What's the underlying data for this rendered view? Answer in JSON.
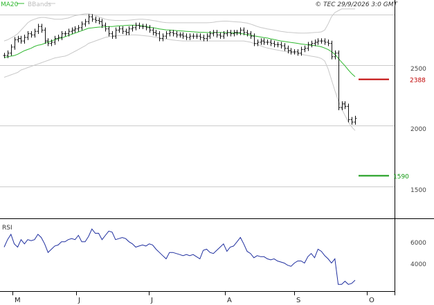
{
  "legend": {
    "ma_label": "MA20",
    "bb_label": "BBands"
  },
  "copyright": "© TEC 29/9/2026 3:0 GMT",
  "colors": {
    "ma": "#2fb82f",
    "bands": "#c8c8c8",
    "price": "#111111",
    "rsi": "#1f2f9f",
    "resistance": "#c00000",
    "support": "#139a13",
    "grid": "#cccccc"
  },
  "chart_data": [
    {
      "type": "ohlc",
      "name": "Price",
      "ylim": [
        1240,
        2970
      ],
      "y_ticks": [
        2500,
        2000,
        1500
      ],
      "y_tick_labels": [
        "2500",
        "2000",
        "1500"
      ],
      "x_months": [
        "M",
        "J",
        "J",
        "A",
        "S",
        "O"
      ],
      "levels": [
        {
          "kind": "resistance",
          "value": 2388,
          "label": "2388"
        },
        {
          "kind": "support",
          "value": 1590,
          "label": "1590"
        }
      ],
      "price_close": [
        2580,
        2600,
        2650,
        2710,
        2720,
        2700,
        2730,
        2760,
        2750,
        2780,
        2820,
        2790,
        2700,
        2680,
        2690,
        2720,
        2730,
        2760,
        2760,
        2780,
        2790,
        2800,
        2810,
        2840,
        2860,
        2900,
        2880,
        2870,
        2860,
        2830,
        2800,
        2760,
        2740,
        2790,
        2800,
        2780,
        2770,
        2800,
        2810,
        2830,
        2820,
        2820,
        2810,
        2790,
        2770,
        2760,
        2720,
        2740,
        2760,
        2770,
        2760,
        2750,
        2750,
        2740,
        2730,
        2740,
        2740,
        2740,
        2730,
        2720,
        2740,
        2760,
        2770,
        2750,
        2740,
        2760,
        2770,
        2760,
        2770,
        2770,
        2790,
        2770,
        2760,
        2740,
        2680,
        2690,
        2700,
        2690,
        2690,
        2680,
        2670,
        2670,
        2660,
        2640,
        2620,
        2610,
        2610,
        2600,
        2630,
        2640,
        2670,
        2680,
        2690,
        2700,
        2700,
        2690,
        2680,
        2570,
        2600,
        2150,
        2180,
        2160,
        2050,
        2030,
        2060
      ],
      "ma20": [
        2560,
        2570,
        2575,
        2580,
        2590,
        2605,
        2620,
        2630,
        2640,
        2655,
        2665,
        2670,
        2680,
        2690,
        2700,
        2710,
        2720,
        2725,
        2735,
        2745,
        2755,
        2765,
        2775,
        2785,
        2795,
        2805,
        2808,
        2812,
        2815,
        2816,
        2818,
        2820,
        2820,
        2822,
        2825,
        2826,
        2828,
        2830,
        2830,
        2830,
        2828,
        2825,
        2820,
        2815,
        2810,
        2805,
        2800,
        2796,
        2792,
        2790,
        2788,
        2786,
        2784,
        2782,
        2780,
        2778,
        2776,
        2774,
        2772,
        2772,
        2770,
        2770,
        2770,
        2770,
        2770,
        2770,
        2770,
        2768,
        2766,
        2765,
        2762,
        2758,
        2752,
        2748,
        2742,
        2738,
        2733,
        2728,
        2724,
        2718,
        2712,
        2706,
        2700,
        2696,
        2692,
        2688,
        2684,
        2680,
        2675,
        2672,
        2668,
        2665,
        2662,
        2658,
        2652,
        2642,
        2630,
        2612,
        2590,
        2558,
        2525,
        2495,
        2460,
        2430,
        2405
      ],
      "bb_upper": [
        2700,
        2710,
        2725,
        2740,
        2760,
        2790,
        2820,
        2850,
        2870,
        2880,
        2890,
        2895,
        2895,
        2890,
        2885,
        2880,
        2880,
        2880,
        2885,
        2890,
        2900,
        2910,
        2915,
        2920,
        2925,
        2925,
        2920,
        2912,
        2900,
        2890,
        2880,
        2875,
        2872,
        2870,
        2870,
        2870,
        2870,
        2872,
        2875,
        2878,
        2880,
        2880,
        2878,
        2875,
        2870,
        2866,
        2860,
        2855,
        2852,
        2850,
        2850,
        2850,
        2850,
        2850,
        2850,
        2850,
        2850,
        2850,
        2850,
        2850,
        2850,
        2852,
        2855,
        2860,
        2862,
        2864,
        2864,
        2862,
        2860,
        2858,
        2856,
        2852,
        2848,
        2840,
        2830,
        2820,
        2812,
        2806,
        2800,
        2795,
        2790,
        2785,
        2780,
        2776,
        2772,
        2770,
        2768,
        2766,
        2765,
        2765,
        2766,
        2768,
        2770,
        2772,
        2775,
        2790,
        2840,
        2900,
        2935,
        2950,
        2965,
        2965,
        2965,
        2965,
        2965
      ],
      "bb_lower": [
        2400,
        2410,
        2420,
        2430,
        2440,
        2460,
        2470,
        2480,
        2490,
        2500,
        2510,
        2520,
        2530,
        2540,
        2550,
        2560,
        2565,
        2570,
        2575,
        2585,
        2600,
        2615,
        2630,
        2645,
        2660,
        2680,
        2690,
        2700,
        2710,
        2720,
        2730,
        2735,
        2740,
        2742,
        2745,
        2746,
        2748,
        2750,
        2750,
        2750,
        2748,
        2745,
        2742,
        2740,
        2735,
        2730,
        2725,
        2720,
        2716,
        2712,
        2708,
        2705,
        2702,
        2700,
        2700,
        2700,
        2700,
        2700,
        2700,
        2700,
        2700,
        2700,
        2700,
        2700,
        2700,
        2700,
        2700,
        2700,
        2700,
        2700,
        2700,
        2700,
        2695,
        2690,
        2680,
        2670,
        2660,
        2650,
        2642,
        2636,
        2630,
        2625,
        2620,
        2615,
        2610,
        2605,
        2600,
        2595,
        2590,
        2585,
        2580,
        2575,
        2570,
        2565,
        2555,
        2535,
        2470,
        2380,
        2290,
        2210,
        2140,
        2085,
        2030,
        1990,
        1960
      ]
    },
    {
      "type": "line",
      "name": "RSI",
      "ylim": [
        15,
        80
      ],
      "y_ticks": [
        60,
        40
      ],
      "y_tick_labels": [
        "6000",
        "4000"
      ],
      "values": [
        55,
        62,
        67,
        58,
        55,
        62,
        58,
        62,
        61,
        62,
        67,
        64,
        58,
        50,
        53,
        56,
        57,
        60,
        60,
        62,
        63,
        62,
        66,
        60,
        60,
        65,
        72,
        68,
        68,
        62,
        66,
        70,
        69,
        62,
        63,
        64,
        63,
        60,
        58,
        55,
        56,
        57,
        56,
        58,
        57,
        53,
        50,
        47,
        44,
        50,
        50,
        49,
        48,
        47,
        48,
        47,
        48,
        46,
        44,
        52,
        53,
        50,
        49,
        52,
        55,
        58,
        51,
        55,
        56,
        60,
        64,
        58,
        51,
        49,
        45,
        47,
        46,
        46,
        44,
        43,
        44,
        42,
        41,
        40,
        38,
        37,
        40,
        42,
        42,
        40,
        46,
        49,
        45,
        53,
        51,
        47,
        44,
        40,
        44,
        20,
        20,
        23,
        20,
        21,
        24
      ]
    }
  ]
}
